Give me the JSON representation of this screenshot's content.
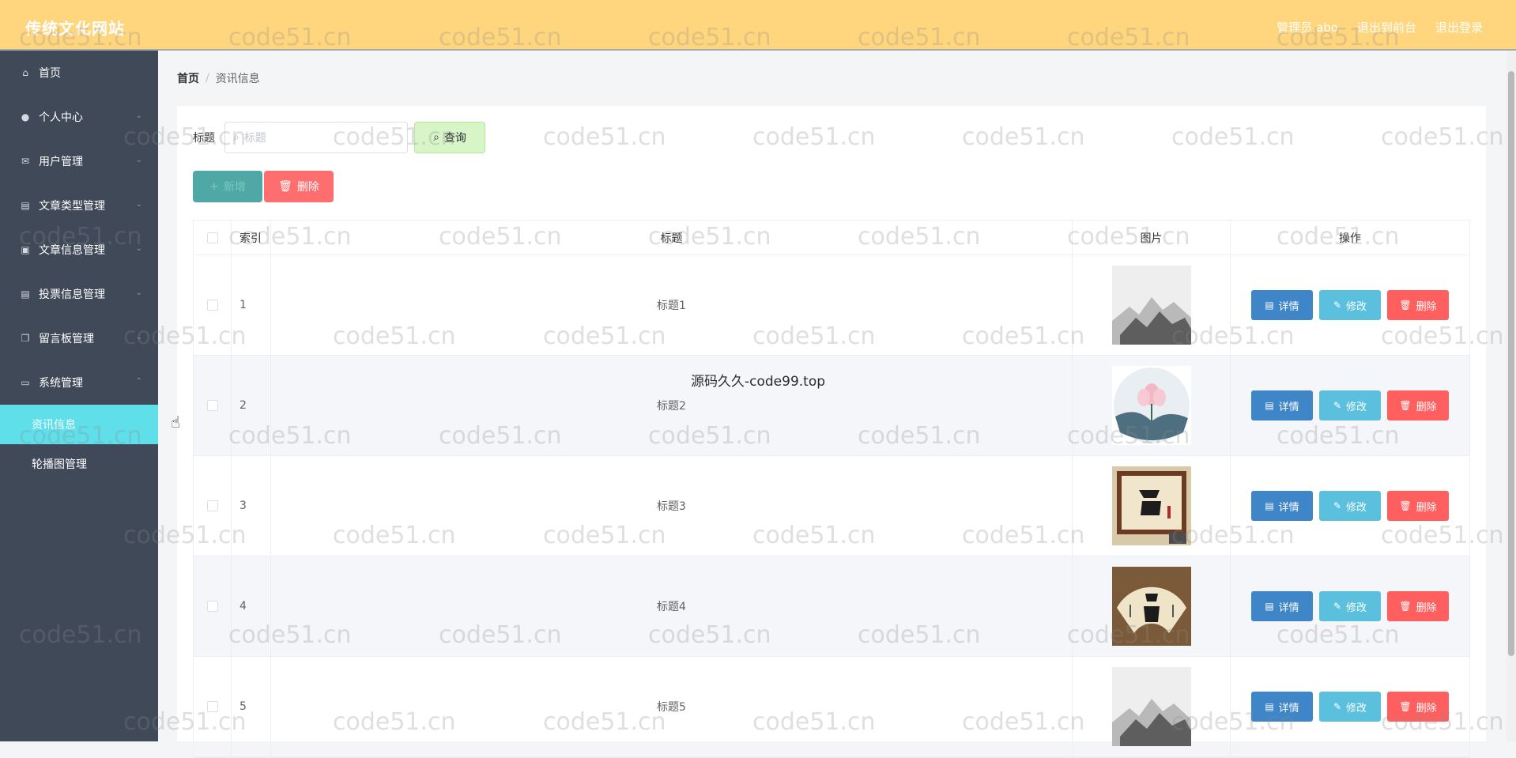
{
  "header": {
    "site_title": "传统文化网站",
    "admin_label": "管理员 abo",
    "to_front": "退出到前台",
    "logout": "退出登录"
  },
  "sidebar": {
    "items": [
      {
        "label": "首页",
        "icon": "home-icon"
      },
      {
        "label": "个人中心",
        "icon": "user-icon"
      },
      {
        "label": "用户管理",
        "icon": "mail-icon"
      },
      {
        "label": "文章类型管理",
        "icon": "clipboard-icon"
      },
      {
        "label": "文章信息管理",
        "icon": "briefcase-icon"
      },
      {
        "label": "投票信息管理",
        "icon": "clipboard-icon"
      },
      {
        "label": "留言板管理",
        "icon": "copy-icon"
      },
      {
        "label": "系统管理",
        "icon": "screen-icon"
      }
    ],
    "sub_items": [
      {
        "label": "资讯信息",
        "active": true
      },
      {
        "label": "轮播图管理",
        "active": false
      }
    ]
  },
  "breadcrumb": {
    "home": "首页",
    "separator": "/",
    "current": "资讯信息"
  },
  "search": {
    "label": "标题",
    "placeholder": "标题",
    "query_button": "查询"
  },
  "actions": {
    "add_button": "新增",
    "delete_button": "删除"
  },
  "table": {
    "headers": {
      "index": "索引",
      "title": "标题",
      "image": "图片",
      "operation": "操作"
    },
    "rows": [
      {
        "index": "1",
        "title": "标题1",
        "image": "ink-landscape"
      },
      {
        "index": "2",
        "title": "标题2",
        "image": "lotus-circle"
      },
      {
        "index": "3",
        "title": "标题3",
        "image": "calligraphy-frame"
      },
      {
        "index": "4",
        "title": "标题4",
        "image": "calligraphy-fan"
      },
      {
        "index": "5",
        "title": "标题5",
        "image": "ink-landscape"
      }
    ],
    "row_buttons": {
      "detail": "详情",
      "edit": "修改",
      "delete": "删除"
    }
  },
  "center_note": "源码久久-code99.top",
  "watermark": "code51.cn",
  "colors": {
    "header_bg": "#ffd67e",
    "sidebar_bg": "#404958",
    "active_sub": "#5edfea"
  }
}
